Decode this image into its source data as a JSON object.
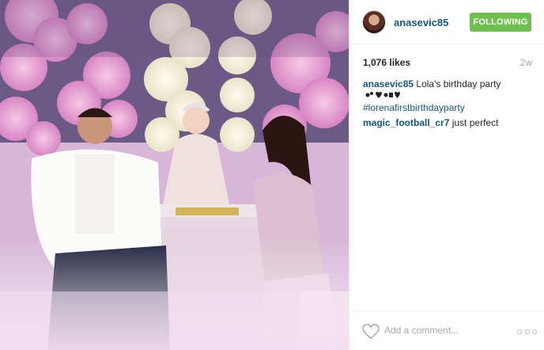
{
  "post": {
    "image": {
      "description_icon": "photo-image"
    },
    "header": {
      "username": "anasevic85",
      "follow_label": "FOLLOWING"
    },
    "likes": "1,076 likes",
    "timestamp": "2w",
    "comments": [
      {
        "user": "anasevic85",
        "text": "Lola's birthday party",
        "tag": "#lorenafirstbirthdayparty"
      },
      {
        "user": "magic_football_cr7",
        "text": "just perfect"
      }
    ],
    "footer": {
      "comment_placeholder": "Add a comment...",
      "more_label": "○○○"
    },
    "colors": {
      "link_blue": "#125688",
      "follow_green": "#70c050",
      "muted_gray": "#a5a7aa"
    }
  }
}
